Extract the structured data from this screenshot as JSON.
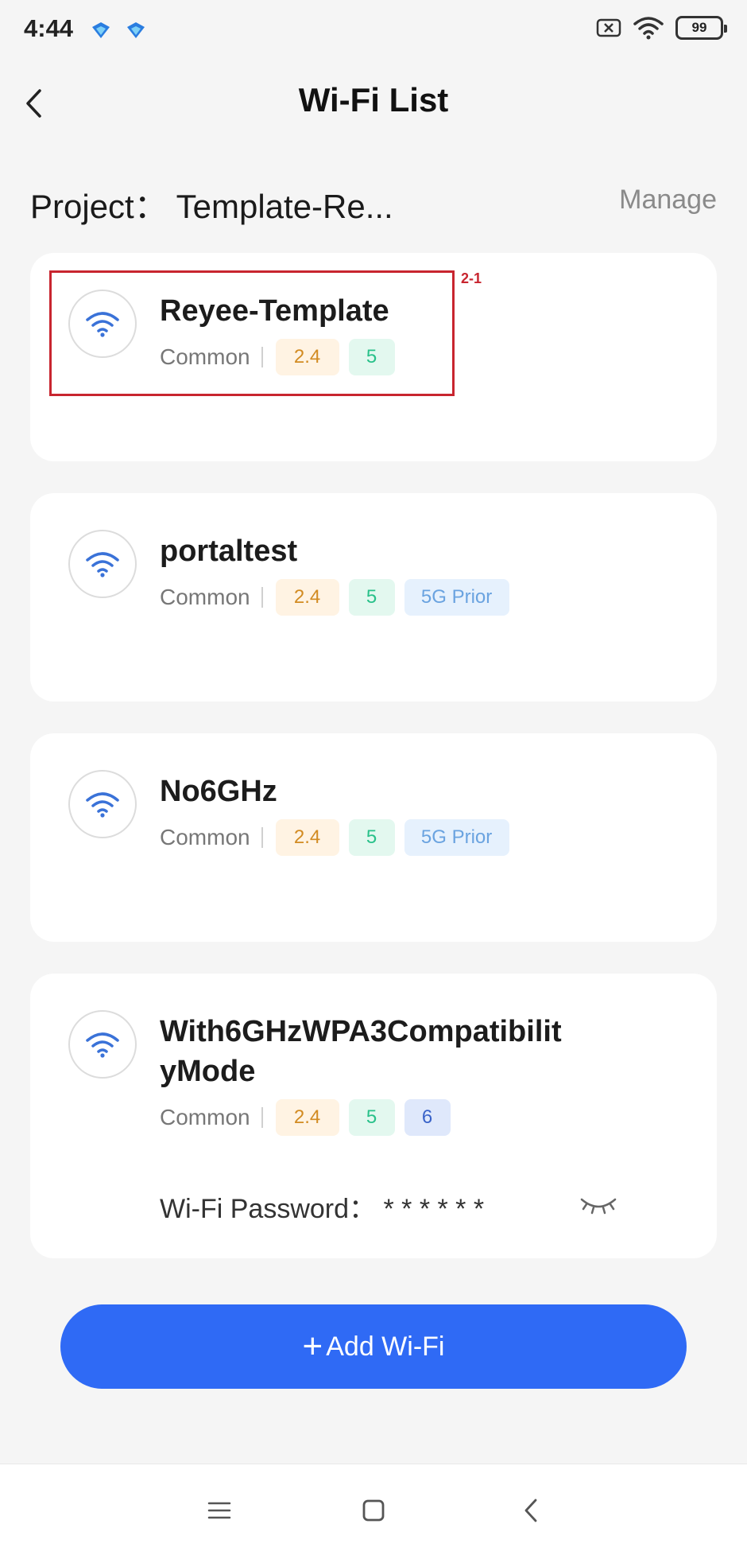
{
  "status_bar": {
    "time": "4:44",
    "battery": "99",
    "icons": [
      "app-badge-icon",
      "mute-icon",
      "wifi-signal-icon",
      "battery-icon"
    ]
  },
  "header": {
    "title": "Wi-Fi List",
    "back_icon": "chevron-left-icon"
  },
  "project": {
    "label": "Project： Template-Re...",
    "manage_label": "Manage"
  },
  "annotation": {
    "label": "2-1",
    "color": "#c8252f"
  },
  "wifi_list": [
    {
      "ssid": "Reyee-Template",
      "auth": "Common",
      "band_24": "2.4",
      "band_5": "5"
    },
    {
      "ssid": "portaltest",
      "auth": "Common",
      "band_24": "2.4",
      "band_5": "5",
      "prior": "5G Prior"
    },
    {
      "ssid": "No6GHz",
      "auth": "Common",
      "band_24": "2.4",
      "band_5": "5",
      "prior": "5G Prior"
    },
    {
      "ssid_line1": "With6GHzWPA3Compatibilit",
      "ssid_line2": "yMode",
      "auth": "Common",
      "band_24": "2.4",
      "band_5": "5",
      "band_6": "6",
      "password_label": "Wi-Fi Password： * * * * * *",
      "eye_icon": "eye-closed-icon"
    }
  ],
  "add_button": {
    "plus": "+",
    "label": "Add Wi-Fi"
  },
  "colors": {
    "accent": "#2f6af5",
    "tag_24_bg": "#fff3e3",
    "tag_24_text": "#d28b22",
    "tag_5_bg": "#e3f8ef",
    "tag_5_text": "#29c18a",
    "tag_6_bg": "#dfe8fb",
    "tag_6_text": "#3a63c9",
    "tag_prior_bg": "#e6f1fd",
    "tag_prior_text": "#6aa3e0"
  },
  "nav_bar": [
    "menu-icon",
    "home-square-icon",
    "back-triangle-icon"
  ]
}
